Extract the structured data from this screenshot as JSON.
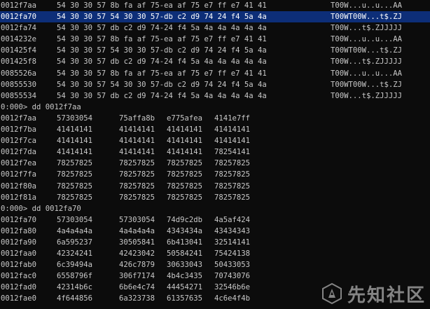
{
  "window": {
    "title": ""
  },
  "terminal": {
    "bytes_rows": [
      {
        "addr": "0012f7aa",
        "bytes": "54 30 30 57 8b fa af 75-ea af 75 e7 ff e7 41 41",
        "ascii": "T00W...u..u...AA",
        "selected": false
      },
      {
        "addr": "0012fa70",
        "bytes": "54 30 30 57 54 30 30 57-db c2 d9 74 24 f4 5a 4a",
        "ascii": "T00WT00W...t$.ZJ",
        "selected": true
      },
      {
        "addr": "0012fa74",
        "bytes": "54 30 30 57 db c2 d9 74-24 f4 5a 4a 4a 4a 4a 4a",
        "ascii": "T00W...t$.ZJJJJJ",
        "selected": false
      },
      {
        "addr": "0014232e",
        "bytes": "54 30 30 57 8b fa af 75-ea af 75 e7 ff e7 41 41",
        "ascii": "T00W...u..u...AA",
        "selected": false
      },
      {
        "addr": "001425f4",
        "bytes": "54 30 30 57 54 30 30 57-db c2 d9 74 24 f4 5a 4a",
        "ascii": "T00WT00W...t$.ZJ",
        "selected": false
      },
      {
        "addr": "001425f8",
        "bytes": "54 30 30 57 db c2 d9 74-24 f4 5a 4a 4a 4a 4a 4a",
        "ascii": "T00W...t$.ZJJJJJ",
        "selected": false
      },
      {
        "addr": "0085526a",
        "bytes": "54 30 30 57 8b fa af 75-ea af 75 e7 ff e7 41 41",
        "ascii": "T00W...u..u...AA",
        "selected": false
      },
      {
        "addr": "00855530",
        "bytes": "54 30 30 57 54 30 30 57-db c2 d9 74 24 f4 5a 4a",
        "ascii": "T00WT00W...t$.ZJ",
        "selected": false
      },
      {
        "addr": "00855534",
        "bytes": "54 30 30 57 db c2 d9 74-24 f4 5a 4a 4a 4a 4a 4a",
        "ascii": "T00W...t$.ZJJJJJ",
        "selected": false
      }
    ],
    "dumps": [
      {
        "command": "0:000> dd 0012f7aa",
        "rows": [
          {
            "addr": "0012f7aa",
            "d": [
              "57303054",
              "75affa8b",
              "e775afea",
              "4141e7ff"
            ]
          },
          {
            "addr": "0012f7ba",
            "d": [
              "41414141",
              "41414141",
              "41414141",
              "41414141"
            ]
          },
          {
            "addr": "0012f7ca",
            "d": [
              "41414141",
              "41414141",
              "41414141",
              "41414141"
            ]
          },
          {
            "addr": "0012f7da",
            "d": [
              "41414141",
              "41414141",
              "41414141",
              "78254141"
            ]
          },
          {
            "addr": "0012f7ea",
            "d": [
              "78257825",
              "78257825",
              "78257825",
              "78257825"
            ]
          },
          {
            "addr": "0012f7fa",
            "d": [
              "78257825",
              "78257825",
              "78257825",
              "78257825"
            ]
          },
          {
            "addr": "0012f80a",
            "d": [
              "78257825",
              "78257825",
              "78257825",
              "78257825"
            ]
          },
          {
            "addr": "0012f81a",
            "d": [
              "78257825",
              "78257825",
              "78257825",
              "78257825"
            ]
          }
        ]
      },
      {
        "command": "0:000> dd 0012fa70",
        "rows": [
          {
            "addr": "0012fa70",
            "d": [
              "57303054",
              "57303054",
              "74d9c2db",
              "4a5af424"
            ]
          },
          {
            "addr": "0012fa80",
            "d": [
              "4a4a4a4a",
              "4a4a4a4a",
              "4343434a",
              "43434343"
            ]
          },
          {
            "addr": "0012fa90",
            "d": [
              "6a595237",
              "30505841",
              "6b413041",
              "32514141"
            ]
          },
          {
            "addr": "0012faa0",
            "d": [
              "42324241",
              "42423042",
              "50584241",
              "75424138"
            ]
          },
          {
            "addr": "0012fab0",
            "d": [
              "6c39494a",
              "426c7879",
              "30633043",
              "50433053"
            ]
          },
          {
            "addr": "0012fac0",
            "d": [
              "6558796f",
              "306f7174",
              "4b4c3435",
              "70743076"
            ]
          },
          {
            "addr": "0012fad0",
            "d": [
              "42314b6c",
              "6b6e4c74",
              "44454271",
              "32546b6e"
            ]
          },
          {
            "addr": "0012fae0",
            "d": [
              "4f644856",
              "6a323738",
              "61357635",
              "4c6e4f4b"
            ]
          }
        ]
      }
    ]
  },
  "watermark": {
    "text": "先知社区",
    "logo_icon": "xianzhi-logo-icon"
  }
}
